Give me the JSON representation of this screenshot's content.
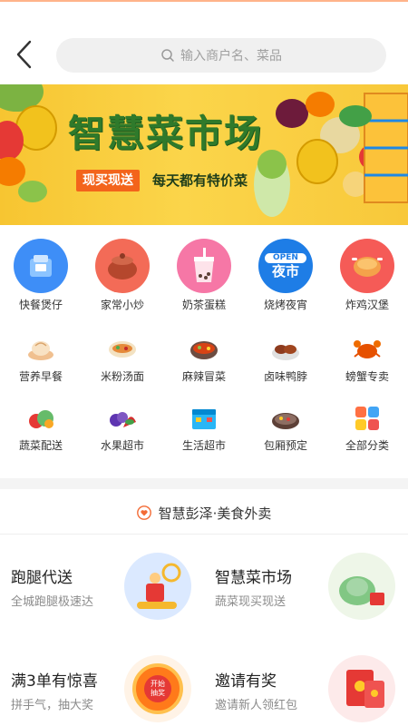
{
  "header": {
    "search_placeholder": "输入商户名、菜品"
  },
  "banner": {
    "title": "智慧菜市场",
    "tag": "现买现送",
    "slogan": "每天都有特价菜"
  },
  "categories": [
    {
      "label": "快餐煲仔",
      "icon": "fast-food-icon"
    },
    {
      "label": "家常小炒",
      "icon": "clay-pot-icon"
    },
    {
      "label": "奶茶蛋糕",
      "icon": "milk-tea-icon"
    },
    {
      "label": "烧烤夜宵",
      "icon": "night-market-icon",
      "icon_text_top": "OPEN",
      "icon_text_bottom": "夜市"
    },
    {
      "label": "炸鸡汉堡",
      "icon": "fried-chicken-icon"
    },
    {
      "label": "营养早餐",
      "icon": "breakfast-icon"
    },
    {
      "label": "米粉汤面",
      "icon": "noodle-icon"
    },
    {
      "label": "麻辣冒菜",
      "icon": "spicy-pot-icon"
    },
    {
      "label": "卤味鸭脖",
      "icon": "braised-duck-icon"
    },
    {
      "label": "螃蟹专卖",
      "icon": "crab-icon"
    },
    {
      "label": "蔬菜配送",
      "icon": "vegetable-icon"
    },
    {
      "label": "水果超市",
      "icon": "fruit-icon"
    },
    {
      "label": "生活超市",
      "icon": "supermarket-icon"
    },
    {
      "label": "包厢预定",
      "icon": "private-room-icon"
    },
    {
      "label": "全部分类",
      "icon": "all-categories-icon"
    }
  ],
  "section": {
    "title": "智慧彭泽·美食外卖"
  },
  "promos": [
    {
      "title": "跑腿代送",
      "subtitle": "全城跑腿极速达",
      "icon": "courier-icon"
    },
    {
      "title": "智慧菜市场",
      "subtitle": "蔬菜现买现送",
      "icon": "vegetable-basket-icon"
    },
    {
      "title": "满3单有惊喜",
      "subtitle": "拼手气，抽大奖",
      "icon": "lottery-icon",
      "badge_line1": "开始",
      "badge_line2": "抽奖"
    },
    {
      "title": "邀请有奖",
      "subtitle": "邀请新人领红包",
      "icon": "red-packet-icon"
    }
  ],
  "colors": {
    "accent": "#f3641b",
    "banner_yellow": "#fbd54a",
    "banner_green": "#2f7a2b"
  }
}
